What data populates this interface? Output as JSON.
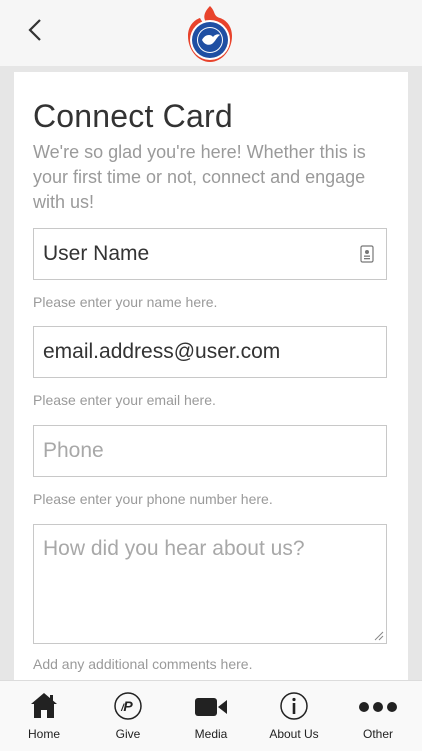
{
  "header": {
    "back_icon": "chevron-left-icon",
    "logo_icon": "flame-dove-logo"
  },
  "form": {
    "title": "Connect Card",
    "subtitle": "We're so glad you're here! Whether this is your first time or not, connect and engage with us!",
    "name_value": "User Name",
    "name_hint": "Please enter your name here.",
    "email_value": "email.address@user.com",
    "email_hint": "Please enter your email here.",
    "phone_placeholder": "Phone",
    "phone_hint": "Please enter your phone number here.",
    "comments_placeholder": "How did you hear about us?",
    "comments_hint": "Add any additional comments here."
  },
  "nav": {
    "items": [
      {
        "label": "Home",
        "icon": "home-icon"
      },
      {
        "label": "Give",
        "icon": "paypal-icon"
      },
      {
        "label": "Media",
        "icon": "video-camera-icon"
      },
      {
        "label": "About Us",
        "icon": "info-icon"
      },
      {
        "label": "Other",
        "icon": "more-icon"
      }
    ]
  },
  "colors": {
    "logo_red": "#e8432c",
    "logo_blue": "#1f4fa3",
    "text_dark": "#333333",
    "text_muted": "#9a9a9a"
  }
}
